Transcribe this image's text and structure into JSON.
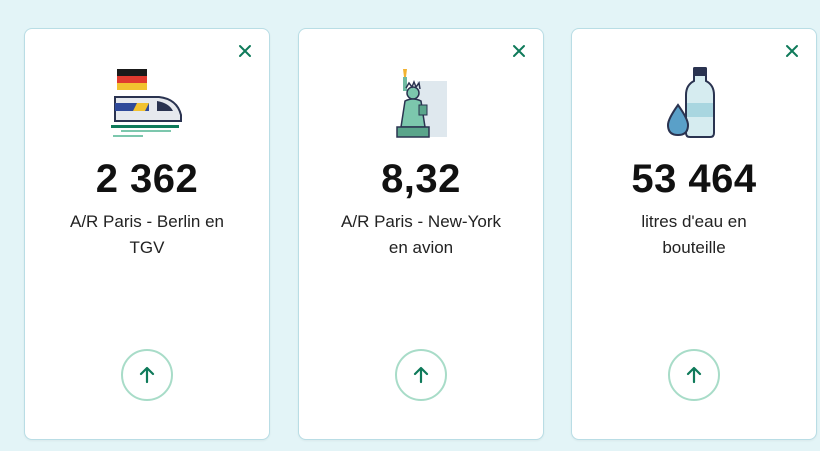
{
  "colors": {
    "panel_bg": "#e3f4f7",
    "card_border": "#b9dde5",
    "accent": "#0f7a5a",
    "button_ring": "#a8dcc8"
  },
  "cards": [
    {
      "icon": "train-germany-icon",
      "value": "2 362",
      "label_line1": "A/R Paris - Berlin en",
      "label_line2": "TGV"
    },
    {
      "icon": "statue-of-liberty-icon",
      "value": "8,32",
      "label_line1": "A/R Paris - New-York",
      "label_line2": "en avion"
    },
    {
      "icon": "water-bottle-icon",
      "value": "53 464",
      "label_line1": "litres d'eau en",
      "label_line2": "bouteille"
    }
  ]
}
